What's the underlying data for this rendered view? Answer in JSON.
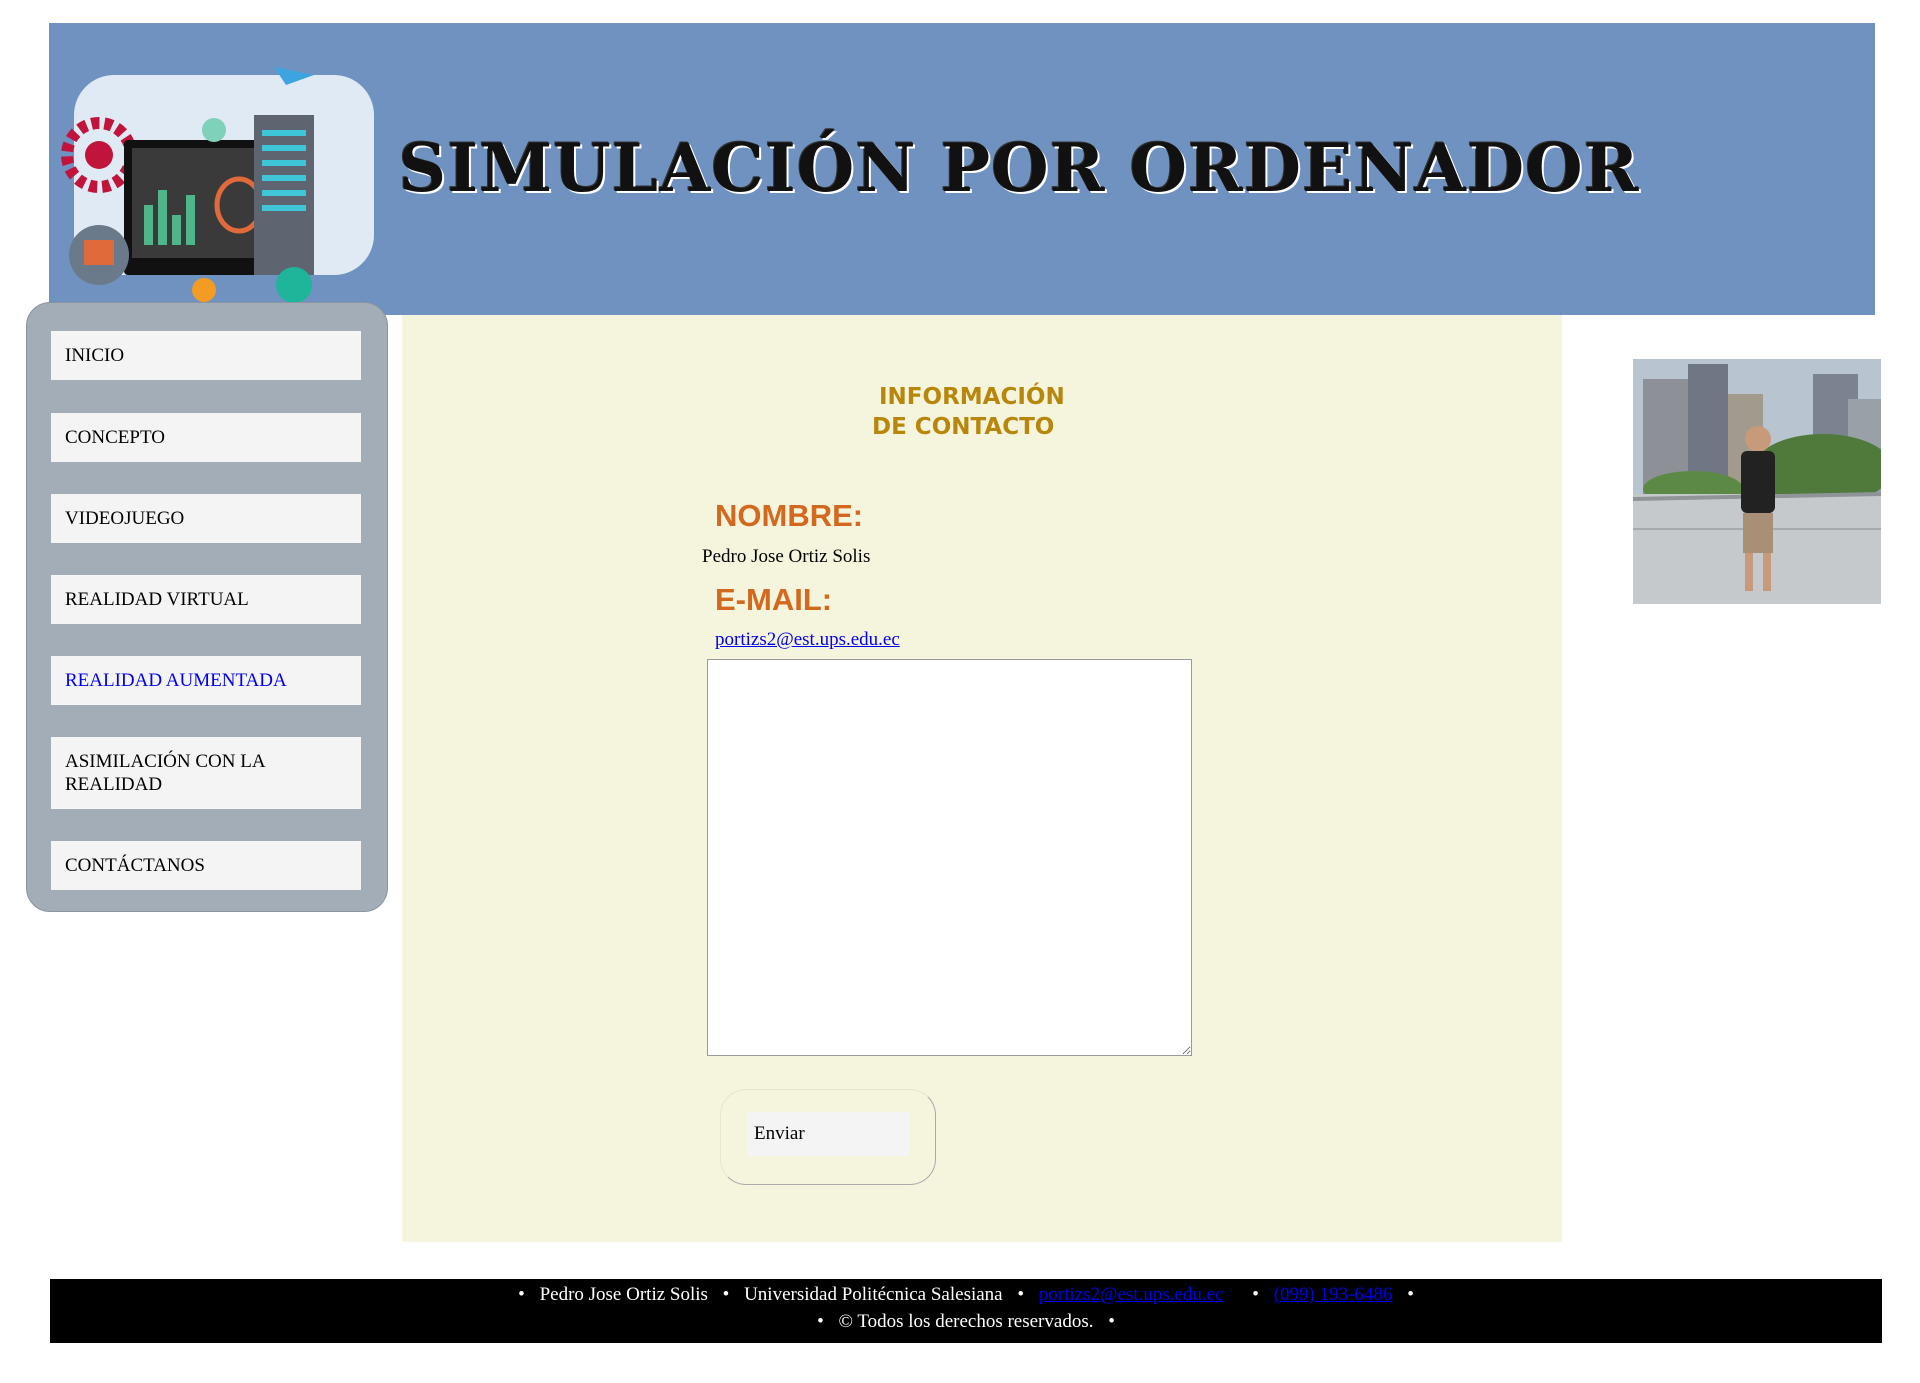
{
  "header": {
    "title": "SIMULACIÓN POR ORDENADOR",
    "logo_icon": "computer-servers-illustration"
  },
  "sidebar": {
    "items": [
      {
        "label": "INICIO"
      },
      {
        "label": "CONCEPTO"
      },
      {
        "label": "VIDEOJUEGO"
      },
      {
        "label": "REALIDAD VIRTUAL"
      },
      {
        "label": "REALIDAD AUMENTADA"
      },
      {
        "label": "ASIMILACIÓN CON LA REALIDAD"
      },
      {
        "label": "CONTÁCTANOS"
      }
    ],
    "active_color": "#0000ee"
  },
  "main": {
    "heading_line1": "INFORMACIÓN",
    "heading_line2": "DE CONTACTO",
    "name_label": "NOMBRE:",
    "name_value": "Pedro Jose Ortiz Solis",
    "email_label": "E-MAIL:",
    "email_value": "portizs2@est.ups.edu.ec",
    "message_value": "",
    "send_label": "Enviar"
  },
  "footer": {
    "name": "Pedro Jose Ortiz Solis",
    "university": "Universidad Politécnica Salesiana",
    "email": "portizs2@est.ups.edu.ec",
    "phone": "(099) 193-6486",
    "copyright": "© Todos los derechos reservados.",
    "bullet": "•"
  },
  "colors": {
    "header_bg": "#7092c1",
    "sidebar_bg": "#a2adb7",
    "main_bg": "#f5f4dc",
    "heading": "#b8860b",
    "label": "#d2691e",
    "footer_bg": "#000000"
  }
}
